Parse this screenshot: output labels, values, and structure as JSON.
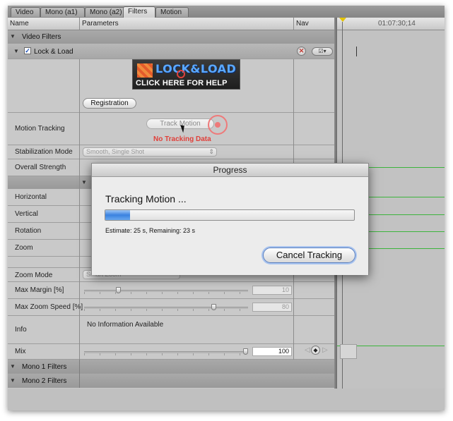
{
  "tabs": [
    {
      "label": "Video",
      "active": false
    },
    {
      "label": "Mono (a1)",
      "active": false
    },
    {
      "label": "Mono (a2)",
      "active": false
    },
    {
      "label": "Filters",
      "active": true
    },
    {
      "label": "Motion",
      "active": false
    }
  ],
  "columns": {
    "name": "Name",
    "parameters": "Parameters",
    "nav": "Nav"
  },
  "timeline": {
    "timecode": "01:07:30;14"
  },
  "sections": {
    "video_filters": "Video Filters",
    "filter_name": "Lock & Load",
    "filter_enabled": true,
    "mono1": "Mono 1 Filters",
    "mono2": "Mono 2 Filters"
  },
  "banner": {
    "title": "LOCK&LOAD",
    "cta": "CLICK HERE FOR HELP",
    "registration_button": "Registration"
  },
  "params": {
    "motion_tracking": {
      "label": "Motion Tracking",
      "button": "Track Motion",
      "status": "No Tracking Data"
    },
    "stabilization_mode": {
      "label": "Stabilization Mode",
      "value": "Smooth, Single Shot"
    },
    "overall_strength": {
      "label": "Overall Strength"
    },
    "horizontal": {
      "label": "Horizontal"
    },
    "vertical": {
      "label": "Vertical"
    },
    "rotation": {
      "label": "Rotation"
    },
    "zoom": {
      "label": "Zoom"
    },
    "zoom_mode": {
      "label": "Zoom Mode",
      "value": "Smart Zoom"
    },
    "max_margin": {
      "label": "Max Margin [%]",
      "value": "10",
      "level": 0.2
    },
    "max_zoom_speed": {
      "label": "Max Zoom Speed [%]",
      "value": "80",
      "level": 0.8
    },
    "info": {
      "label": "Info",
      "value": "No Information Available"
    },
    "mix": {
      "label": "Mix",
      "value": "100",
      "level": 1.0
    }
  },
  "dialog": {
    "title": "Progress",
    "message": "Tracking Motion ...",
    "estimate": "Estimate:  25 s, Remaining:  23 s",
    "progress": 0.1,
    "cancel_button": "Cancel Tracking"
  },
  "colors": {
    "accent_red": "#e0403a",
    "track_green": "#3cb43c",
    "progress_blue": "#3a82e0"
  }
}
